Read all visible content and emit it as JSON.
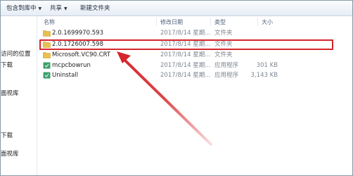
{
  "toolbar": {
    "organize_label": "包含到库中",
    "share_label": "共享",
    "new_folder_label": "新建文件夹"
  },
  "nav": {
    "items": [
      "访问的位置",
      "下载",
      "面视库",
      "下载",
      "面视库"
    ]
  },
  "columns": {
    "name": "名称",
    "date": "修改日期",
    "type": "类型",
    "size": "大小"
  },
  "files": [
    {
      "name": "2.0.1699970.593",
      "date": "2017/8/14 星期...",
      "type": "文件夹",
      "size": "",
      "icon": "folder-icon"
    },
    {
      "name": "2.0.1726007.598",
      "date": "2017/8/14 星期...",
      "type": "文件夹",
      "size": "",
      "icon": "folder-icon"
    },
    {
      "name": "Microsoft.VC90.CRT",
      "date": "2017/8/14 星期...",
      "type": "文件夹",
      "size": "",
      "icon": "folder-icon"
    },
    {
      "name": "mcpcbowrun",
      "date": "2017/8/14 星期...",
      "type": "应用程序",
      "size": "301 KB",
      "icon": "app-icon"
    },
    {
      "name": "Uninstall",
      "date": "2017/8/14 星期...",
      "type": "应用程序",
      "size": "3,143 KB",
      "icon": "app-icon"
    }
  ],
  "colors": {
    "highlight": "#d4262b",
    "arrow": "#d4262b",
    "folder": "#e9c04f",
    "app": "#3c9f6b"
  }
}
